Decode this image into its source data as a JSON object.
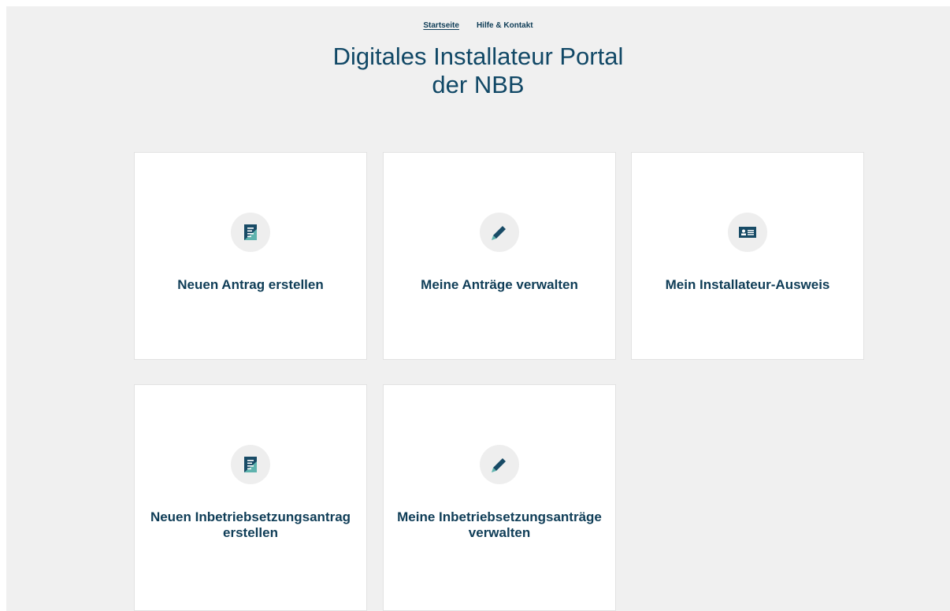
{
  "nav": {
    "items": [
      {
        "label": "Startseite",
        "active": true
      },
      {
        "label": "Hilfe & Kontakt",
        "active": false
      }
    ]
  },
  "header": {
    "title_line1": "Digitales Installateur Portal",
    "title_line2": "der NBB"
  },
  "cards": [
    {
      "label": "Neuen Antrag erstellen",
      "icon": "document-icon"
    },
    {
      "label": "Meine Anträge verwalten",
      "icon": "pencil-icon"
    },
    {
      "label": "Mein Installateur-Ausweis",
      "icon": "id-card-icon"
    },
    {
      "label_line1": "Neuen Inbetriebsetzungsantrag",
      "label_line2": "erstellen",
      "icon": "document-icon"
    },
    {
      "label_line1": "Meine Inbetriebsetzungsanträge",
      "label_line2": "verwalten",
      "icon": "pencil-icon"
    }
  ],
  "colors": {
    "primary": "#0f3d57",
    "icon_dark": "#184b66",
    "icon_light": "#5fb3ae",
    "background": "#f0f0f0",
    "card": "#ffffff"
  }
}
